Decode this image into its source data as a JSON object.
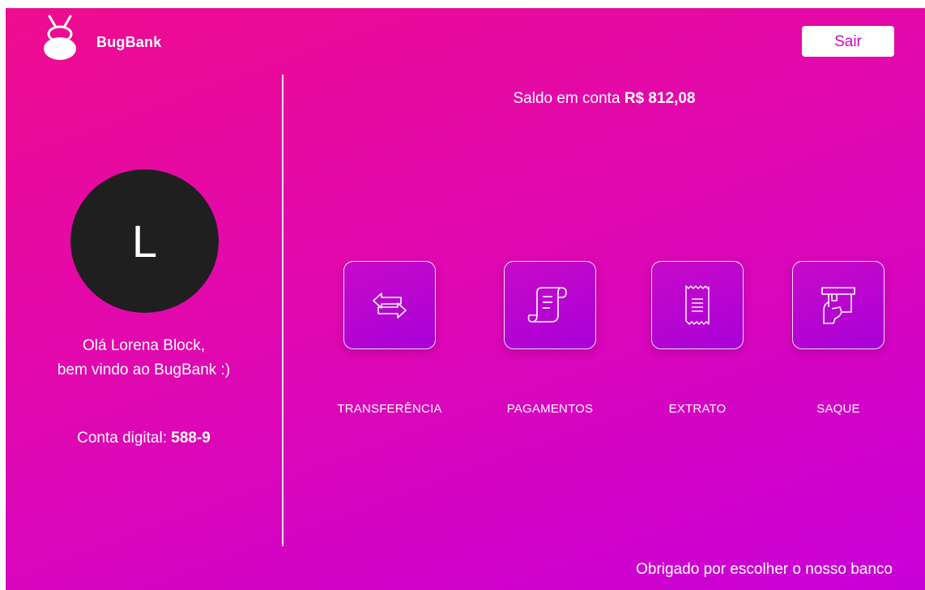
{
  "app": {
    "brand": "BugBank"
  },
  "header": {
    "logout_label": "Sair"
  },
  "profile": {
    "initial": "L",
    "greeting_line1": "Olá Lorena Block,",
    "greeting_line2": "bem vindo ao BugBank :)",
    "account_label": "Conta digital:",
    "account_number": "588-9"
  },
  "balance": {
    "label": "Saldo em conta",
    "value": "R$ 812,08"
  },
  "actions": [
    {
      "label": "TRANSFERÊNCIA",
      "icon": "transfer-arrows-icon"
    },
    {
      "label": "PAGAMENTOS",
      "icon": "scroll-payment-icon"
    },
    {
      "label": "EXTRATO",
      "icon": "receipt-icon"
    },
    {
      "label": "SAQUE",
      "icon": "atm-withdraw-icon"
    }
  ],
  "footer": {
    "text": "Obrigado por escolher o nosso banco"
  },
  "colors": {
    "gradient_start": "#ee0c8f",
    "gradient_end": "#c800d8",
    "avatar_bg": "#1f1f1f",
    "button_text": "#cc06c4"
  }
}
